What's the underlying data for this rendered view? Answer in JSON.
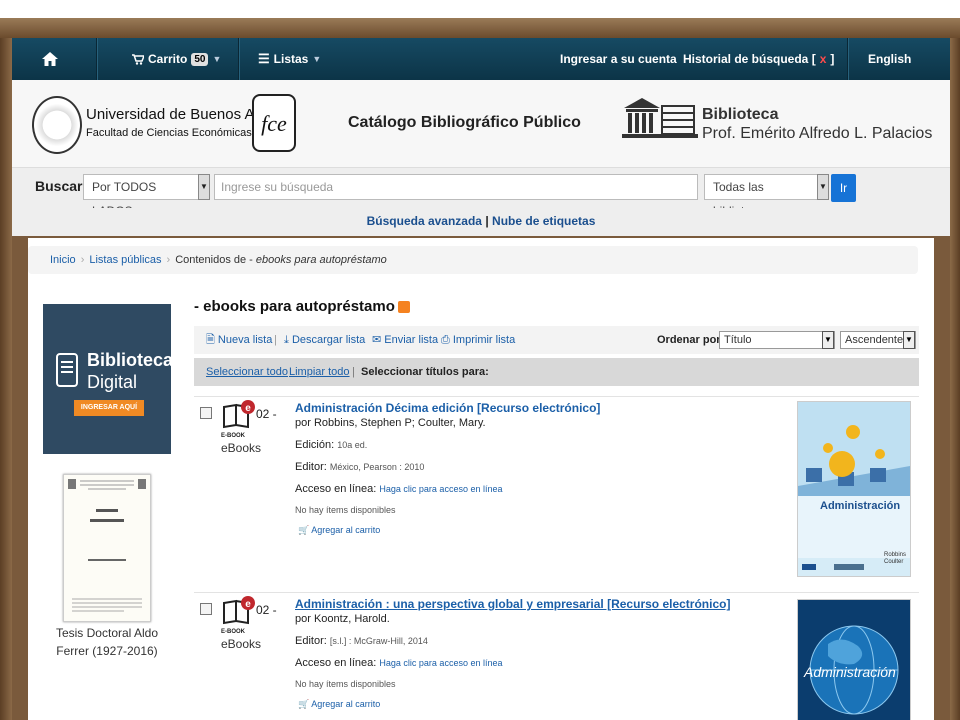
{
  "navbar": {
    "home_icon": "home-icon",
    "cart_label": "Carrito",
    "cart_count": "50",
    "lists_label": "Listas",
    "login_label": "Ingresar a su cuenta",
    "history_label": "Historial de búsqueda [",
    "history_clear": "x",
    "history_close": "]",
    "language_label": "English"
  },
  "header": {
    "university": "Universidad de Buenos Aires",
    "faculty": "Facultad de Ciencias Económicas",
    "fce_logo": "fce",
    "catalog_title": "Catálogo Bibliográfico Público",
    "library_title": "Biblioteca",
    "library_name": "Prof. Emérito Alfredo L. Palacios"
  },
  "search": {
    "label": "Buscar",
    "scope": "Por TODOS LADOS",
    "placeholder": "Ingrese su búsqueda",
    "library": "Todas las bibliotecas",
    "go_label": "Ir",
    "advanced_label": "Búsqueda avanzada",
    "separator": "|",
    "tags_label": "Nube de etiquetas"
  },
  "breadcrumb": {
    "home": "Inicio",
    "public_lists": "Listas públicas",
    "current_prefix": "Contenidos de - ",
    "current_list": "ebooks para autopréstamo"
  },
  "sidebar": {
    "promo_title": "Biblioteca",
    "promo_sub": "Digital",
    "promo_button": "INGRESAR AQUÍ",
    "tesis_caption": "Tesis Doctoral Aldo Ferrer (1927-2016)"
  },
  "list": {
    "title": "- ebooks para autopréstamo",
    "toolbar": {
      "new_list": "Nueva lista",
      "download_list": "Descargar lista",
      "send_list": "Enviar lista",
      "print_list": "Imprimir lista",
      "sort_label": "Ordenar por :",
      "sort_field": "Título",
      "sort_order": "Ascendente"
    },
    "selection": {
      "select_all": "Seleccionar todo",
      "clear_all": "Limpiar todo",
      "select_titles": "Seleccionar títulos para:"
    },
    "records": [
      {
        "number": "02 -",
        "icon_label": "E-BOOK",
        "type": "eBooks",
        "title": "Administración Décima edición [Recurso electrónico]",
        "authors": "por Robbins, Stephen P; Coulter, Mary.",
        "edition_label": "Edición:",
        "edition": "10a ed.",
        "publisher_label": "Editor:",
        "publisher": "México, Pearson : 2010",
        "access_label": "Acceso en línea:",
        "access_link": "Haga clic para acceso en línea",
        "availability": "No hay ítems disponibles",
        "cart": "Agregar al carrito",
        "cover_title": "Administración",
        "cover_authors": "Robbins\nCoulter"
      },
      {
        "number": "02 -",
        "icon_label": "E-BOOK",
        "type": "eBooks",
        "title": "Administración : una perspectiva global y empresarial [Recurso electrónico]",
        "authors": "por Koontz, Harold.",
        "publisher_label": "Editor:",
        "publisher": "[s.l.] : McGraw-Hill, 2014",
        "access_label": "Acceso en línea:",
        "access_link": "Haga clic para acceso en línea",
        "availability": "No hay ítems disponibles",
        "cart": "Agregar al carrito",
        "cover_title": "Administración"
      }
    ]
  },
  "colors": {
    "navbar": "#0c3447",
    "link": "#1b5fa8",
    "go_button": "#1673d6",
    "promo": "#2f4a62",
    "promo_button": "#f08a24",
    "rss": "#f58220",
    "ebook_badge": "#c0272d"
  }
}
